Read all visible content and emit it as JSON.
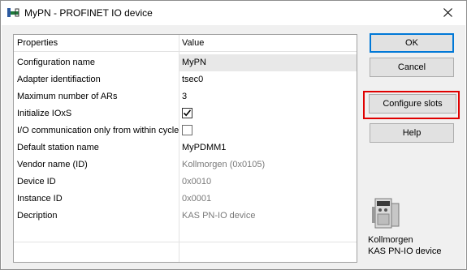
{
  "window": {
    "title": "MyPN - PROFINET IO device"
  },
  "grid": {
    "header": {
      "name": "Properties",
      "value": "Value"
    },
    "rows": [
      {
        "name": "Configuration name",
        "value": "MyPN"
      },
      {
        "name": "Adapter identifiaction",
        "value": "tsec0"
      },
      {
        "name": "Maximum number of ARs",
        "value": "3"
      },
      {
        "name": "Initialize IOxS",
        "checked": true
      },
      {
        "name": "I/O communication only from within cycle",
        "checked": false
      },
      {
        "name": "Default station name",
        "value": "MyPDMM1"
      },
      {
        "name": "Vendor name (ID)",
        "value": "Kollmorgen (0x0105)"
      },
      {
        "name": "Device ID",
        "value": "0x0010"
      },
      {
        "name": "Instance ID",
        "value": "0x0001"
      },
      {
        "name": "Decription",
        "value": "KAS PN-IO device"
      }
    ]
  },
  "buttons": {
    "ok": "OK",
    "cancel": "Cancel",
    "configure_slots": "Configure slots",
    "help": "Help"
  },
  "device": {
    "vendor": "Kollmorgen",
    "product": "KAS PN-IO device",
    "icon": "drive-device-icon"
  },
  "colors": {
    "highlight": "#e00000",
    "default_button_border": "#0078d7",
    "grey_value": "#7a7a7a"
  }
}
